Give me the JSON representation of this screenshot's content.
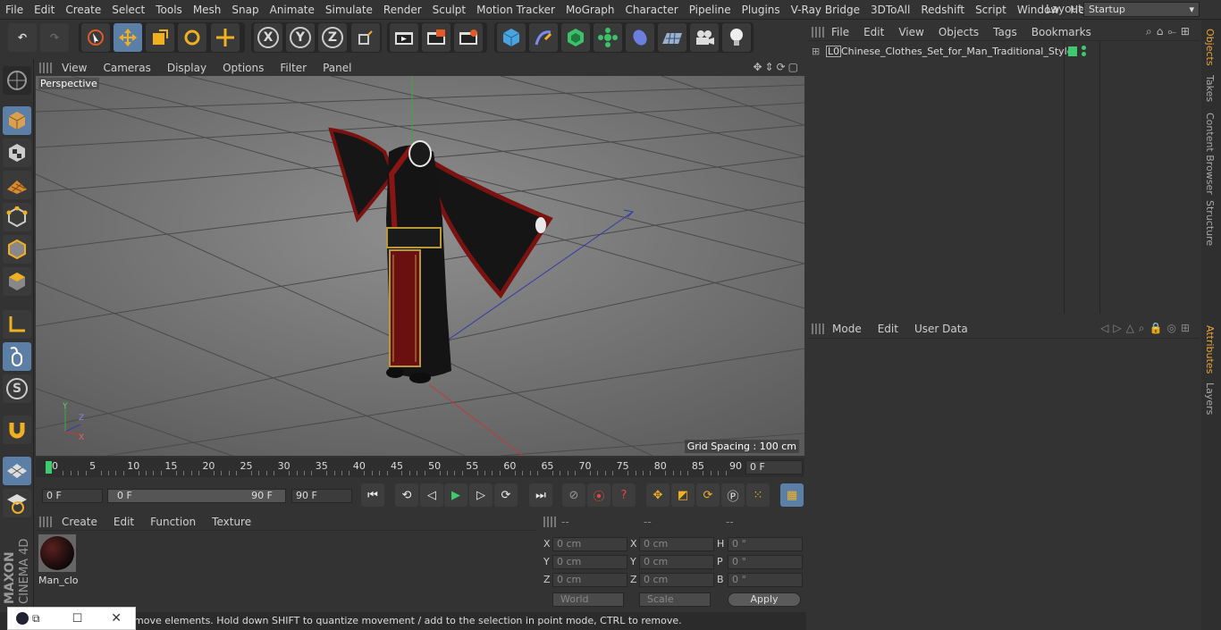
{
  "menu": [
    "File",
    "Edit",
    "Create",
    "Select",
    "Tools",
    "Mesh",
    "Snap",
    "Animate",
    "Simulate",
    "Render",
    "Sculpt",
    "Motion Tracker",
    "MoGraph",
    "Character",
    "Pipeline",
    "Plugins",
    "V-Ray Bridge",
    "3DToAll",
    "Redshift",
    "Script",
    "Window",
    "Help"
  ],
  "layout": {
    "label": "Layout:",
    "value": "Startup"
  },
  "toolbar": {
    "x": "X",
    "y": "Y",
    "z": "Z"
  },
  "viewport": {
    "menu": [
      "View",
      "Cameras",
      "Display",
      "Options",
      "Filter",
      "Panel"
    ],
    "label": "Perspective",
    "grid_spacing": "Grid Spacing : 100 cm"
  },
  "timeline": {
    "ticks": [
      "0",
      "5",
      "10",
      "15",
      "20",
      "25",
      "30",
      "35",
      "40",
      "45",
      "50",
      "55",
      "60",
      "65",
      "70",
      "75",
      "80",
      "85",
      "90"
    ],
    "current": "0 F"
  },
  "transport": {
    "start": "0 F",
    "range_start": "0 F",
    "range_end": "90 F",
    "end": "90 F"
  },
  "material_menu": [
    "Create",
    "Edit",
    "Function",
    "Texture"
  ],
  "material": {
    "name": "Man_clo"
  },
  "coords": {
    "headers": [
      "--",
      "--",
      "--"
    ],
    "rows": [
      {
        "a": "X",
        "av": "0 cm",
        "b": "X",
        "bv": "0 cm",
        "c": "H",
        "cv": "0 °"
      },
      {
        "a": "Y",
        "av": "0 cm",
        "b": "Y",
        "bv": "0 cm",
        "c": "P",
        "cv": "0 °"
      },
      {
        "a": "Z",
        "av": "0 cm",
        "b": "Z",
        "bv": "0 cm",
        "c": "B",
        "cv": "0 °"
      }
    ],
    "mode1": "World",
    "mode2": "Scale",
    "apply": "Apply"
  },
  "status": "move elements. Hold down SHIFT to quantize movement / add to the selection in point mode, CTRL to remove.",
  "objects": {
    "menu": [
      "File",
      "Edit",
      "View",
      "Objects",
      "Tags",
      "Bookmarks"
    ],
    "item": "Chinese_Clothes_Set_for_Man_Traditional_Style"
  },
  "attributes": {
    "menu": [
      "Mode",
      "Edit",
      "User Data"
    ]
  },
  "side_tabs": [
    "Objects",
    "Takes",
    "Content Browser",
    "Structure",
    "Attributes",
    "Layers"
  ],
  "logo": {
    "line1": "MAXON",
    "line2": "CINEMA 4D"
  },
  "colors": {
    "accent": "#5b7fa6",
    "tab_active": "#e8a53a",
    "robe": "#141414",
    "trim": "#8a1515",
    "gold": "#b8963a"
  }
}
